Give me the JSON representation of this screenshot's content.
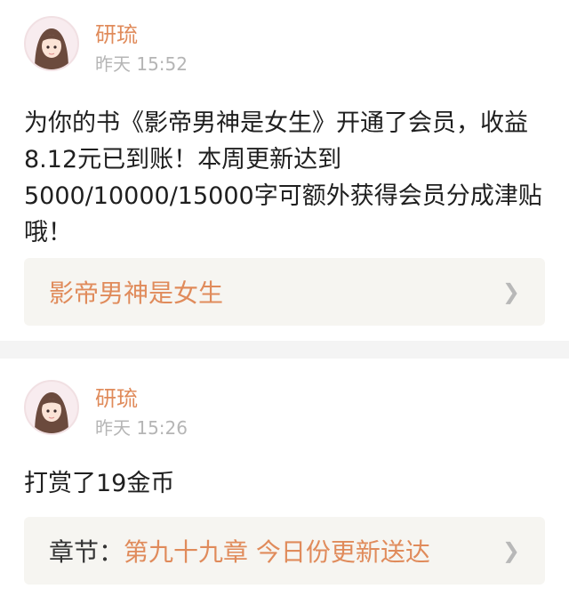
{
  "posts": [
    {
      "author": "研琉",
      "time": "昨天 15:52",
      "message": "为你的书《影帝男神是女生》开通了会员，收益8.12元已到账！本周更新达到5000/10000/15000字可额外获得会员分成津贴哦！",
      "link_title": "影帝男神是女生"
    },
    {
      "author": "研琉",
      "time": "昨天 15:26",
      "message": "打赏了19金币",
      "chapter_label": "章节：",
      "chapter_text": "第九十九章  今日份更新送达"
    }
  ],
  "icons": {
    "chevron": "chevron-right-icon",
    "avatar": "avatar-image"
  },
  "colors": {
    "accent": "#e08b5b",
    "time": "#b5b5b5",
    "box_bg": "#f6f5f1"
  }
}
